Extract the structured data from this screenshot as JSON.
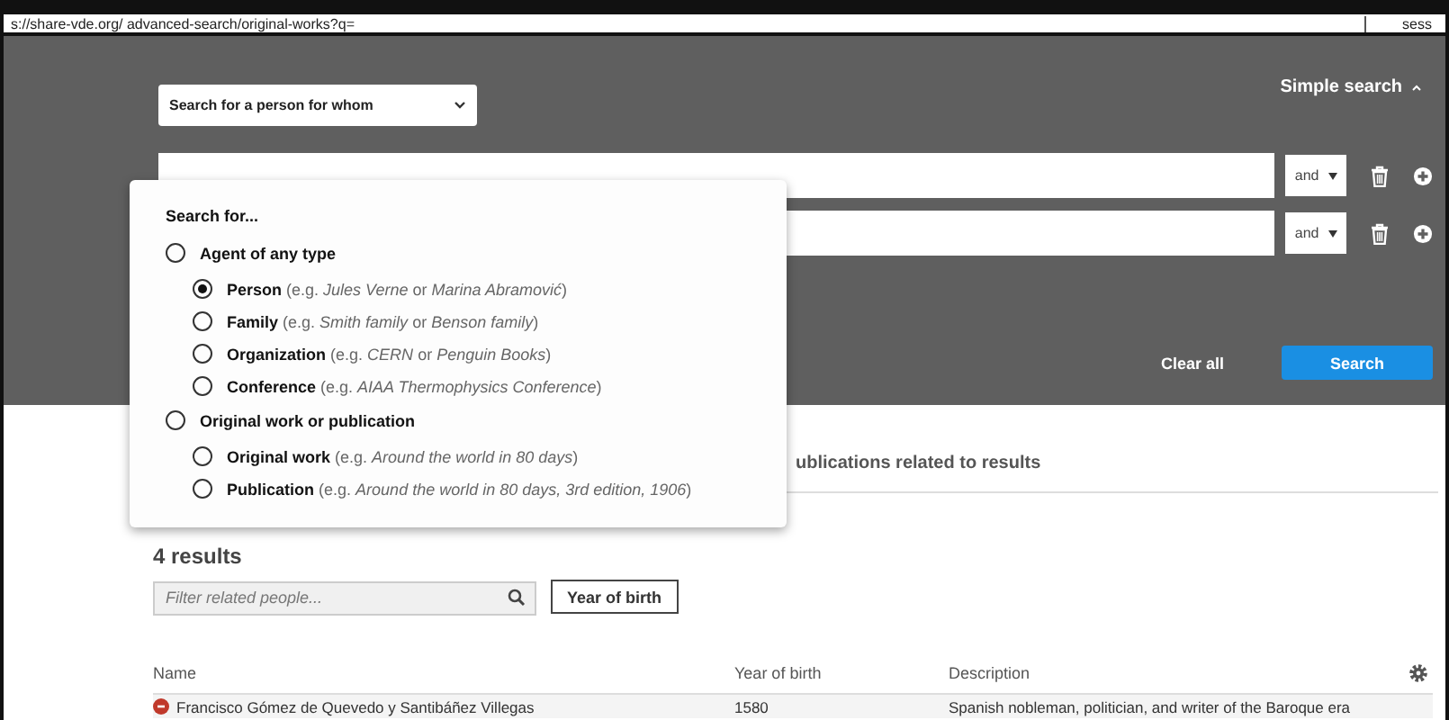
{
  "address_bar": {
    "url": "s://share-vde.org/ advanced-search/original-works?q=",
    "side_text": "sess"
  },
  "search_panel": {
    "type_select": "Search for a person for whom",
    "simple_search": "Simple search",
    "rows": [
      {
        "operator": "and"
      },
      {
        "operator": "and"
      }
    ],
    "clear_all": "Clear all",
    "search_button": "Search"
  },
  "popup": {
    "title": "Search for...",
    "options": [
      {
        "label": "Agent of any type",
        "selected": false,
        "children": [
          {
            "label": "Person",
            "example": "(e.g. *Jules Verne* or *Marina Abramović*)",
            "selected": true
          },
          {
            "label": "Family",
            "example": "(e.g. *Smith family* or *Benson family*)",
            "selected": false
          },
          {
            "label": "Organization",
            "example": "(e.g. *CERN* or *Penguin Books*)",
            "selected": false
          },
          {
            "label": "Conference",
            "example": "(e.g. *AIAA Thermophysics Conference*)",
            "selected": false
          }
        ]
      },
      {
        "label": "Original work or publication",
        "selected": false,
        "children": [
          {
            "label": "Original work",
            "example": "(e.g. *Around the world in 80 days*)",
            "selected": false
          },
          {
            "label": "Publication",
            "example": "(e.g. *Around the world in 80 days, 3rd edition, 1906*)",
            "selected": false
          }
        ]
      }
    ]
  },
  "results_tab": "ublications related to results",
  "results": {
    "count": "4 results",
    "filter_placeholder": "Filter related people...",
    "year_button": "Year of birth",
    "columns": [
      "Name",
      "Year of birth",
      "Description"
    ],
    "rows": [
      {
        "name": "Francisco Gómez de Quevedo y Santibáñez Villegas",
        "year": "1580",
        "description": "Spanish nobleman, politician, and writer of the Baroque era"
      }
    ]
  }
}
